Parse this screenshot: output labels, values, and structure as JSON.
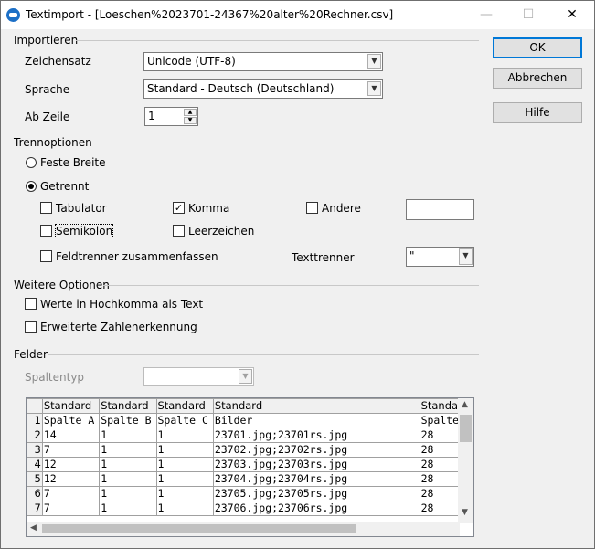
{
  "window": {
    "title": "Textimport - [Loeschen%2023701-24367%20alter%20Rechner.csv]",
    "minimize": "—",
    "maximize": "☐",
    "close": "✕"
  },
  "import": {
    "heading": "Importieren",
    "charset_label": "Zeichensatz",
    "charset_value": "Unicode (UTF-8)",
    "language_label": "Sprache",
    "language_value": "Standard - Deutsch (Deutschland)",
    "fromrow_label": "Ab Zeile",
    "fromrow_value": "1"
  },
  "separators": {
    "heading": "Trennoptionen",
    "fixed_width": "Feste Breite",
    "separated": "Getrennt",
    "tab": "Tabulator",
    "comma": "Komma",
    "other": "Andere",
    "semicolon": "Semikolon",
    "space": "Leerzeichen",
    "merge": "Feldtrenner zusammenfassen",
    "text_delim_label": "Texttrenner",
    "text_delim_value": "\"",
    "selected_mode": "separated",
    "checked": [
      "comma"
    ]
  },
  "other_options": {
    "heading": "Weitere Optionen",
    "quoted_as_text": "Werte in Hochkomma als Text",
    "detect_numbers": "Erweiterte Zahlenerkennung"
  },
  "fields": {
    "heading": "Felder",
    "column_type_label": "Spaltentyp",
    "column_type_value": ""
  },
  "buttons": {
    "ok": "OK",
    "cancel": "Abbrechen",
    "help": "Hilfe"
  },
  "grid": {
    "headers": [
      "Standard",
      "Standard",
      "Standard",
      "Standard",
      "Standard"
    ],
    "rows": [
      [
        "1",
        "Spalte A",
        "Spalte B",
        "Spalte C",
        "Bilder",
        "Spalte E"
      ],
      [
        "2",
        "14",
        "1",
        "1",
        "23701.jpg;23701rs.jpg",
        "28"
      ],
      [
        "3",
        "7",
        "1",
        "1",
        "23702.jpg;23702rs.jpg",
        "28"
      ],
      [
        "4",
        "12",
        "1",
        "1",
        "23703.jpg;23703rs.jpg",
        "28"
      ],
      [
        "5",
        "12",
        "1",
        "1",
        "23704.jpg;23704rs.jpg",
        "28"
      ],
      [
        "6",
        "7",
        "1",
        "1",
        "23705.jpg;23705rs.jpg",
        "28"
      ],
      [
        "7",
        "7",
        "1",
        "1",
        "23706.jpg;23706rs.jpg",
        "28"
      ]
    ]
  },
  "colors": {
    "accent": "#0078d7",
    "icon": "#1c6fc6"
  }
}
